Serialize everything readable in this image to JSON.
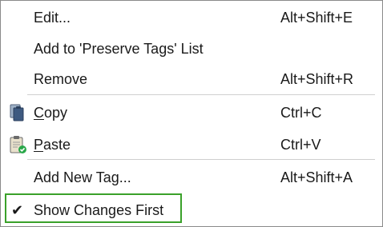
{
  "menu": {
    "items": [
      {
        "label": "Edit...",
        "shortcut": "Alt+Shift+E"
      },
      {
        "label": "Add to 'Preserve Tags' List",
        "shortcut": ""
      },
      {
        "label": "Remove",
        "shortcut": "Alt+Shift+R"
      },
      {
        "label_first": "C",
        "label_rest": "opy",
        "shortcut": "Ctrl+C",
        "icon": "clipboard-copy-icon"
      },
      {
        "label_first": "P",
        "label_rest": "aste",
        "shortcut": "Ctrl+V",
        "icon": "clipboard-paste-icon"
      },
      {
        "label": "Add New Tag...",
        "shortcut": "Alt+Shift+A"
      },
      {
        "label": "Show Changes First",
        "shortcut": "",
        "checked": true,
        "check_glyph": "✔",
        "icon": "checkmark-icon"
      }
    ]
  },
  "colors": {
    "highlight_border": "#3aa12a",
    "separator": "#cfcfcf",
    "paste_badge": "#2aa84a"
  }
}
